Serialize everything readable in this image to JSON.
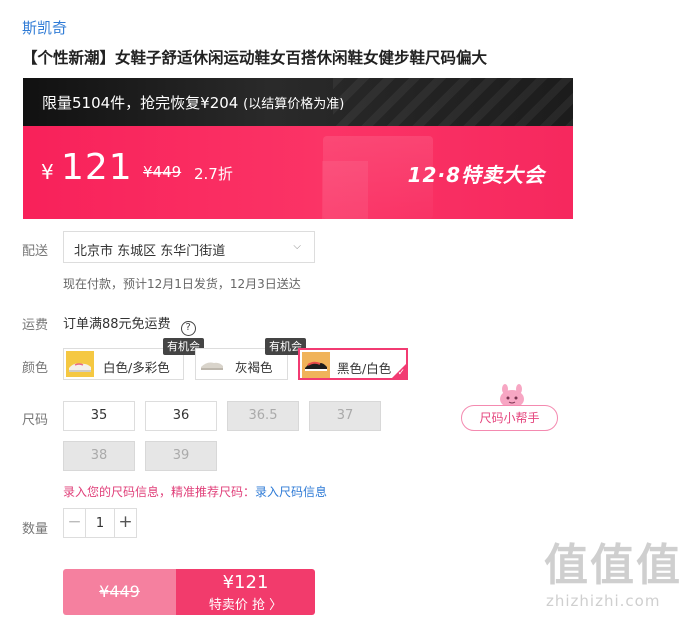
{
  "brand": "斯凯奇",
  "product_title": "【个性新潮】女鞋子舒适休闲运动鞋女百搭休闲鞋女健步鞋尺码偏大",
  "promo": {
    "limit_text": "限量5104件，抢完恢复¥204",
    "limit_note": "(以结算价格为准)",
    "currency": "¥",
    "price": "121",
    "original_price": "¥449",
    "discount": "2.7折",
    "event_tag": "12·8特卖大会"
  },
  "delivery": {
    "label": "配送",
    "address": "北京市 东城区 东华门街道",
    "shipping_note": "现在付款，预计12月1日发货，12月3日送达"
  },
  "freight": {
    "label": "运费",
    "text": "订单满88元免运费",
    "help_icon": "question-circle-icon",
    "help_glyph": "?"
  },
  "color": {
    "label": "颜色",
    "chance_badge": "有机会",
    "options": [
      {
        "name": "白色/多彩色"
      },
      {
        "name": "灰褐色"
      },
      {
        "name": "黑色/白色",
        "selected": true
      }
    ]
  },
  "size": {
    "label": "尺码",
    "options": [
      {
        "value": "35",
        "available": true
      },
      {
        "value": "36",
        "available": true
      },
      {
        "value": "36.5",
        "available": false
      },
      {
        "value": "37",
        "available": false
      },
      {
        "value": "38",
        "available": false
      },
      {
        "value": "39",
        "available": false
      }
    ],
    "helper_label": "尺码小帮手",
    "record_prompt": "录入您的尺码信息，精准推荐尺码：",
    "record_link": "录入尺码信息"
  },
  "quantity": {
    "label": "数量",
    "minus": "−",
    "value": "1",
    "plus": "+"
  },
  "buy_bar": {
    "original_price": "¥449",
    "price": "¥121",
    "action_label": "特卖价 抢 〉"
  },
  "watermark": {
    "main": "值值值",
    "sub": "zhizhizhi.com"
  },
  "colors": {
    "accent": "#f23b6c",
    "link": "#2f7bd6",
    "promo_red": "#f8215a",
    "dark_banner": "#111111"
  }
}
